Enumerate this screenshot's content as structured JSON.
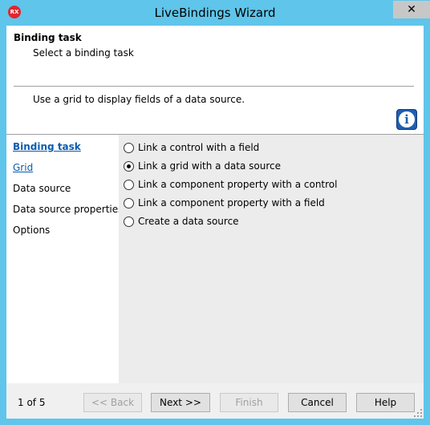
{
  "window": {
    "title": "LiveBindings Wizard",
    "app_icon_text": "RX",
    "close_label": "✕"
  },
  "header": {
    "title": "Binding task",
    "subtitle": "Select a binding task",
    "description": "Use a grid to display fields of a data source.",
    "info_icon_glyph": "i"
  },
  "nav": {
    "items": [
      {
        "label": "Binding task",
        "state": "current-link"
      },
      {
        "label": "Grid",
        "state": "link"
      },
      {
        "label": "Data source",
        "state": "text"
      },
      {
        "label": "Data source properties",
        "state": "text"
      },
      {
        "label": "Options",
        "state": "text"
      }
    ]
  },
  "options": {
    "selected_index": 1,
    "items": [
      {
        "label": "Link a control with a field",
        "checked": false
      },
      {
        "label": "Link a grid with a data source",
        "checked": true
      },
      {
        "label": "Link a component property with a control",
        "checked": false
      },
      {
        "label": "Link a component property with a field",
        "checked": false
      },
      {
        "label": "Create a data source",
        "checked": false
      }
    ]
  },
  "footer": {
    "page_indicator": "1 of 5",
    "back_label": "<< Back",
    "next_label": "Next >>",
    "finish_label": "Finish",
    "cancel_label": "Cancel",
    "help_label": "Help",
    "back_enabled": false,
    "finish_enabled": false
  },
  "colors": {
    "titlebar": "#5fc5ea",
    "link": "#0b5cad",
    "app_icon": "#e1262e"
  }
}
